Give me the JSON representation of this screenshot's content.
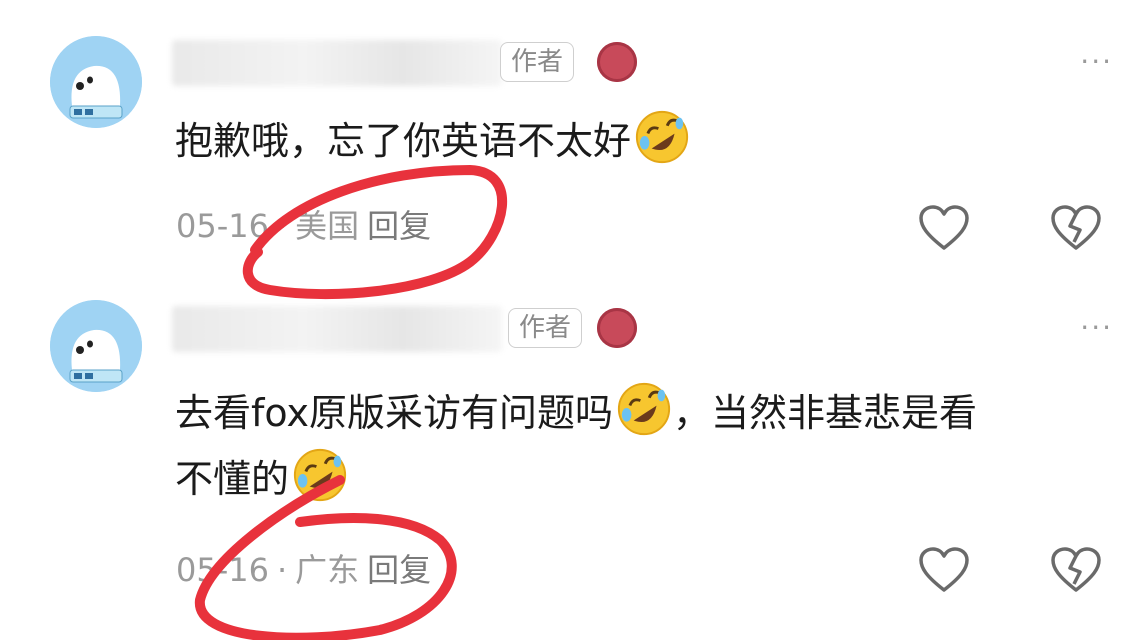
{
  "comments": [
    {
      "badge": "作者",
      "text": "抱歉哦，忘了你英语不太好",
      "text_line2": "",
      "date": "05-16",
      "separator": "·",
      "region": "美国",
      "reply_label": "回复",
      "more_label": "···"
    },
    {
      "badge": "作者",
      "text": "去看fox原版采访有问题吗",
      "text_after_emoji": "，当然非基悲是看",
      "text_line2": "不懂的",
      "date": "05-16",
      "separator": "·",
      "region": "广东",
      "reply_label": "回复",
      "more_label": "···"
    }
  ],
  "icons": {
    "avatar": "polar-bear-avatar",
    "medal": "badge-medal-icon",
    "emoji": "rolling-on-floor-laughing-emoji",
    "like": "heart-outline-icon",
    "dislike": "broken-heart-outline-icon",
    "more": "more-dots-icon"
  },
  "colors": {
    "annotation": "#e8323c",
    "avatar_bg": "#9fd3f3",
    "medal": "#c84a5a",
    "meta_text": "#9a9a9a"
  }
}
